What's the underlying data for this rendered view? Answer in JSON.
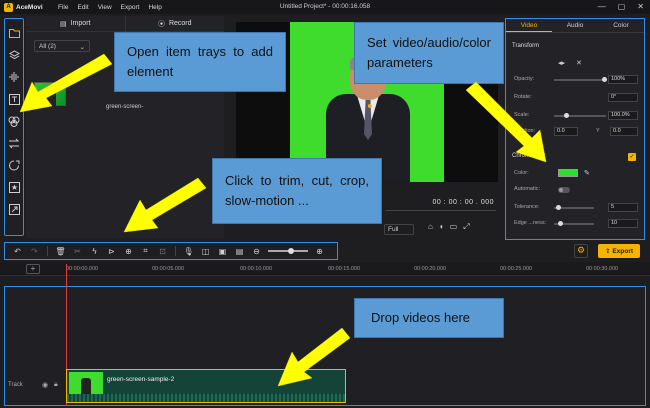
{
  "app": {
    "name": "AceMovi",
    "title": "Untitled Project* - 00:00:16.058",
    "menu": [
      "File",
      "Edit",
      "View",
      "Export",
      "Help"
    ],
    "window_controls": [
      "—",
      "▢",
      "✕"
    ]
  },
  "rail": {
    "icons": [
      "folder-icon",
      "layers-icon",
      "audio-icon",
      "text-icon",
      "overlay-icon",
      "transition-icon",
      "filter-icon",
      "sticker-icon",
      "pip-icon"
    ]
  },
  "media": {
    "tab_import": "Import",
    "tab_record": "Record",
    "dropdown_value": "All (2)",
    "clip_label": "green-screen-"
  },
  "preview": {
    "time": "00 : 00 : 00 . 000",
    "zoom": "Full"
  },
  "props": {
    "tabs": [
      "Video",
      "Audio",
      "Color"
    ],
    "section_transform": "Transform",
    "opacity_label": "Opacity:",
    "opacity_value": "100%",
    "rotate_label": "Rotate:",
    "rotate_value": "0°",
    "scale_label": "Scale:",
    "scale_value": "100.0%",
    "position_label": "Position:",
    "pos_x_label": "X",
    "pos_x_value": "0.0",
    "pos_y_label": "Y",
    "pos_y_value": "0.0",
    "chroma_label": "Chroma Key",
    "color_label": "Color:",
    "auto_label": "Automatic:",
    "tolerance_label": "Tolerance:",
    "tolerance_value": "5",
    "edge_label": "Edge ...ness:",
    "edge_value": "10",
    "chroma_color": "#2ee02e"
  },
  "toolbar": {
    "export_label": "Export"
  },
  "ruler": {
    "ticks": [
      "00:00:00.000",
      "00:00:05.000",
      "00:00:10.000",
      "00:00:15.000",
      "00:00:20.000",
      "00:00:25.000",
      "00:00:30.000",
      "00:00:35.000"
    ]
  },
  "timeline": {
    "track_label": "Track",
    "clip_name": "green-screen-sample-2"
  },
  "callouts": {
    "trays": "Open item trays to add element",
    "params": "Set video/audio/color parameters",
    "trim": "Click to trim, cut, crop, slow-motion ...",
    "drop": "Drop videos here"
  },
  "colors": {
    "accent": "#f5b400",
    "highlight": "#2f8ff0",
    "callout_fill": "#5b9bd5",
    "arrow": "#ffff00"
  }
}
